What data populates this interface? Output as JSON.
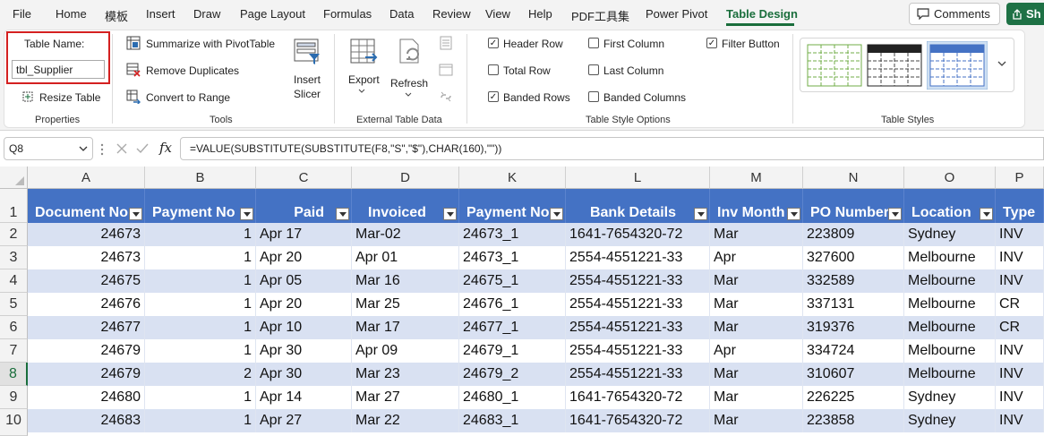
{
  "menu": {
    "tabs": [
      "File",
      "Home",
      "模板",
      "Insert",
      "Draw",
      "Page Layout",
      "Formulas",
      "Data",
      "Review",
      "View",
      "Help",
      "PDF工具集",
      "Power Pivot",
      "Table Design"
    ],
    "comments": "Comments",
    "share": "Sh"
  },
  "ribbon": {
    "properties": {
      "table_name_label": "Table Name:",
      "table_name_value": "tbl_Supplier",
      "resize_label": "Resize Table",
      "group": "Properties"
    },
    "tools": {
      "summarize": "Summarize with PivotTable",
      "remove_duplicates": "Remove Duplicates",
      "convert": "Convert to Range",
      "insert_slicer_1": "Insert",
      "insert_slicer_2": "Slicer",
      "group": "Tools"
    },
    "external": {
      "export": "Export",
      "refresh": "Refresh",
      "group": "External Table Data"
    },
    "style_options": {
      "header_row": "Header Row",
      "total_row": "Total Row",
      "banded_rows": "Banded Rows",
      "first_column": "First Column",
      "last_column": "Last Column",
      "banded_columns": "Banded Columns",
      "filter_button": "Filter Button",
      "group": "Table Style Options"
    },
    "styles": {
      "group": "Table Styles"
    }
  },
  "formula_bar": {
    "name_box": "Q8",
    "fx": "fx",
    "formula": "=VALUE(SUBSTITUTE(SUBSTITUTE(F8,\"S\",\"$\"),CHAR(160),\"\"))"
  },
  "sheet": {
    "col_letters": [
      "A",
      "B",
      "C",
      "D",
      "K",
      "L",
      "M",
      "N",
      "O",
      "P"
    ],
    "headers": [
      "Document No",
      "Payment No",
      "Paid",
      "Invoiced",
      "Payment No",
      "Bank Details",
      "Inv Month",
      "PO Number",
      "Location",
      "Type"
    ],
    "row_numbers": [
      "1",
      "2",
      "3",
      "4",
      "5",
      "6",
      "7",
      "8",
      "9",
      "10"
    ],
    "rows": [
      [
        "24673",
        "1",
        "Apr 17",
        "Mar-02",
        "24673_1",
        "1641-7654320-72",
        "Mar",
        "223809",
        "Sydney",
        "INV"
      ],
      [
        "24673",
        "1",
        "Apr 20",
        "Apr 01",
        "24673_1",
        "2554-4551221-33",
        "Apr",
        "327600",
        "Melbourne",
        "INV"
      ],
      [
        "24675",
        "1",
        "Apr 05",
        "Mar 16",
        "24675_1",
        "2554-4551221-33",
        "Mar",
        "332589",
        "Melbourne",
        "INV"
      ],
      [
        "24676",
        "1",
        "Apr 20",
        "Mar 25",
        "24676_1",
        "2554-4551221-33",
        "Mar",
        "337131",
        "Melbourne",
        "CR"
      ],
      [
        "24677",
        "1",
        "Apr 10",
        "Mar 17",
        "24677_1",
        "2554-4551221-33",
        "Mar",
        "319376",
        "Melbourne",
        "CR"
      ],
      [
        "24679",
        "1",
        "Apr 30",
        "Apr 09",
        "24679_1",
        "2554-4551221-33",
        "Apr",
        "334724",
        "Melbourne",
        "INV"
      ],
      [
        "24679",
        "2",
        "Apr 30",
        "Mar 23",
        "24679_2",
        "2554-4551221-33",
        "Mar",
        "310607",
        "Melbourne",
        "INV"
      ],
      [
        "24680",
        "1",
        "Apr 14",
        "Mar 27",
        "24680_1",
        "1641-7654320-72",
        "Mar",
        "226225",
        "Sydney",
        "INV"
      ],
      [
        "24683",
        "1",
        "Apr 27",
        "Mar 22",
        "24683_1",
        "1641-7654320-72",
        "Mar",
        "223858",
        "Sydney",
        "INV"
      ]
    ]
  },
  "colors": {
    "accent": "#1a6e3c",
    "table_header": "#4472c4",
    "band": "#d9e1f2",
    "highlight": "#d42020"
  }
}
